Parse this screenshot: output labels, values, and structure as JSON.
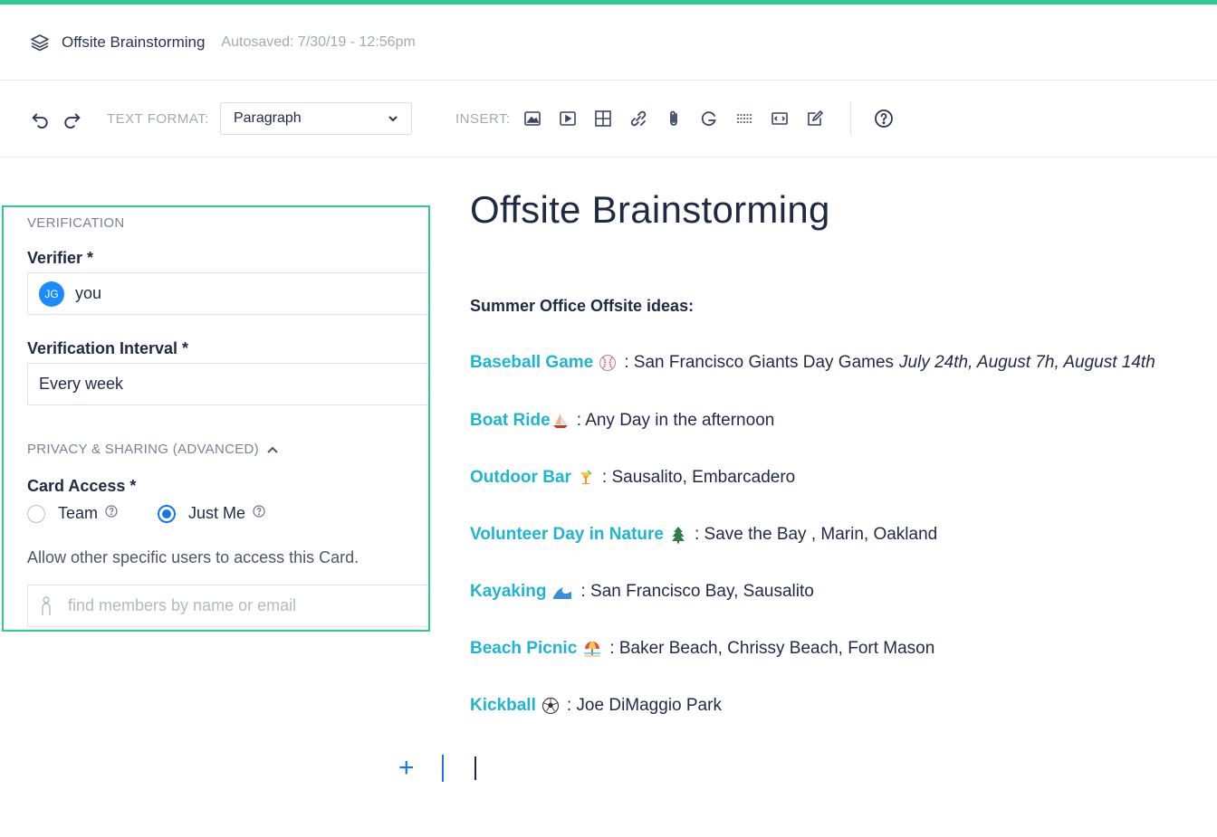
{
  "header": {
    "title": "Offsite Brainstorming",
    "autosaved": "Autosaved: 7/30/19 - 12:56pm"
  },
  "toolbar": {
    "text_format_label": "TEXT FORMAT:",
    "format_value": "Paragraph",
    "insert_label": "INSERT:"
  },
  "panel": {
    "verification_caption": "VERIFICATION",
    "verifier_label": "Verifier *",
    "verifier_initials": "JG",
    "verifier_value": "you",
    "interval_label": "Verification Interval *",
    "interval_value": "Every week",
    "privacy_caption": "PRIVACY & SHARING (ADVANCED)",
    "card_access_label": "Card Access *",
    "option_team": "Team",
    "option_just_me": "Just Me",
    "selected_option": "Just Me",
    "allow_text": "Allow other specific users to access this Card.",
    "member_placeholder": "find members by name or email"
  },
  "document": {
    "heading": "Offsite Brainstorming",
    "subheading": "Summer Office Offsite ideas:",
    "ideas": [
      {
        "name": "Baseball Game",
        "emoji": "baseball-icon",
        "detail": ": San Francisco Giants Day Games",
        "dates": "July 24th, August 7h, August 14th"
      },
      {
        "name": "Boat Ride",
        "emoji": "sailboat-icon",
        "detail": ": Any Day in the afternoon"
      },
      {
        "name": "Outdoor Bar",
        "emoji": "tropical-drink-icon",
        "detail": ": Sausalito, Embarcadero"
      },
      {
        "name": "Volunteer Day in Nature",
        "emoji": "evergreen-tree-icon",
        "detail": ": Save the Bay , Marin, Oakland"
      },
      {
        "name": "Kayaking",
        "emoji": "water-wave-icon",
        "detail": ": San Francisco Bay, Sausalito"
      },
      {
        "name": "Beach Picnic",
        "emoji": "beach-umbrella-icon",
        "detail": ": Baker Beach, Chrissy Beach, Fort Mason"
      },
      {
        "name": "Kickball",
        "emoji": "soccer-ball-icon",
        "detail": ": Joe DiMaggio Park"
      }
    ]
  },
  "colors": {
    "accent": "#2ecc8f",
    "link": "#1fb5d2",
    "primary": "#1a73e8",
    "text": "#1f2a44"
  }
}
